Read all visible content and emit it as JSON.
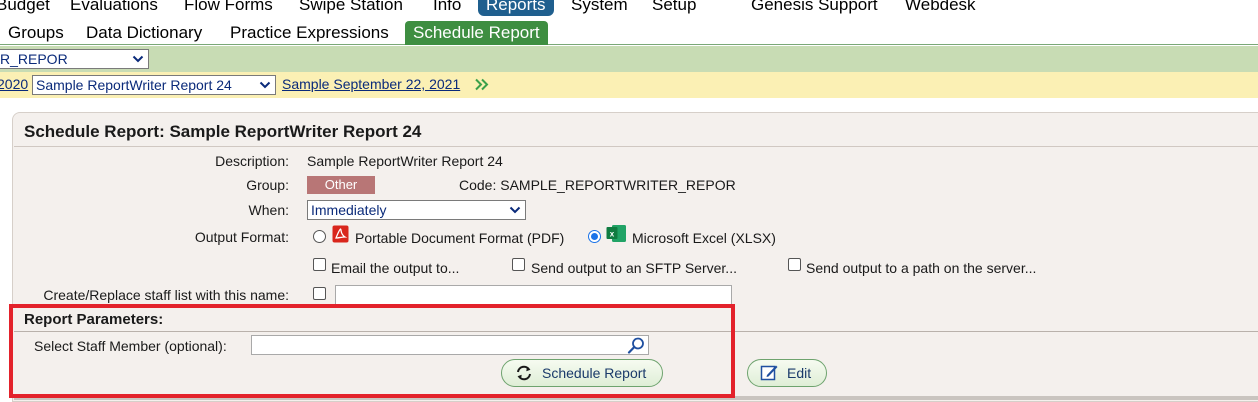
{
  "top_menu": {
    "items": [
      "Budget",
      "Evaluations",
      "Flow Forms",
      "Swipe Station",
      "Info",
      "Reports",
      "System",
      "Setup",
      "Genesis Support",
      "Webdesk"
    ],
    "active": "Reports"
  },
  "sub_tabs": {
    "items": [
      "Groups",
      "Data Dictionary",
      "Practice Expressions",
      "Schedule Report"
    ],
    "active": "Schedule Report"
  },
  "green_bar": {
    "selector_value": "R_REPOR"
  },
  "yellow_bar": {
    "year_link": "2020",
    "report_select_value": "Sample ReportWriter Report 24",
    "date_link": "Sample September 22, 2021",
    "forward_icon": "double-chevron-right-icon"
  },
  "panel": {
    "title": "Schedule Report: Sample ReportWriter Report 24",
    "description_label": "Description:",
    "description_value": "Sample ReportWriter Report 24",
    "group_label": "Group:",
    "group_value": "Other",
    "code_text": "Code: SAMPLE_REPORTWRITER_REPOR",
    "when_label": "When:",
    "when_value": "Immediately",
    "output_format_label": "Output Format:",
    "output_formats": [
      {
        "label": "Portable Document Format (PDF)",
        "icon": "pdf-icon",
        "selected": false
      },
      {
        "label": "Microsoft Excel (XLSX)",
        "icon": "excel-icon",
        "selected": true
      }
    ],
    "delivery_options": [
      {
        "label": "Email the output to...",
        "checked": false
      },
      {
        "label": "Send output to an SFTP Server...",
        "checked": false
      },
      {
        "label": "Send output to a path on the server...",
        "checked": false
      }
    ],
    "staff_list_label": "Create/Replace staff list with this name:",
    "staff_list_checked": false,
    "staff_list_value": ""
  },
  "report_parameters": {
    "title": "Report Parameters:",
    "staff_member_label": "Select Staff Member (optional):",
    "staff_member_value": "",
    "search_icon": "search-icon"
  },
  "buttons": {
    "schedule_label": "Schedule Report",
    "edit_label": "Edit"
  },
  "colors": {
    "active_menu": "#1f5f8e",
    "active_tab": "#3e8e41",
    "green_bar": "#c8dcb4",
    "yellow_bar": "#fbf0b4",
    "group_badge": "#b87676",
    "highlight_box": "#e3222b"
  }
}
